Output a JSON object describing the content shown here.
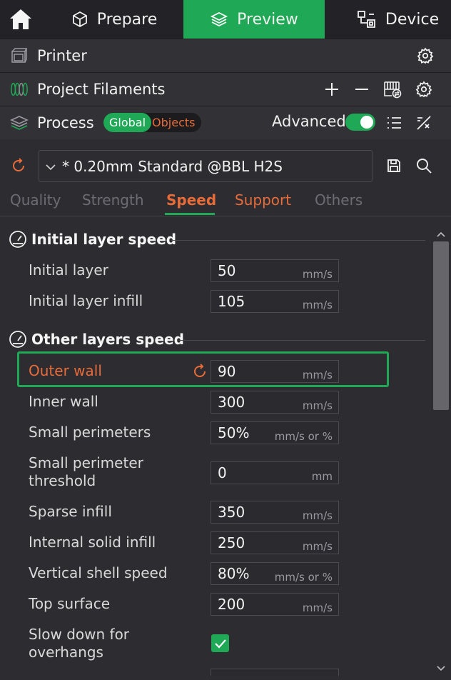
{
  "nav": {
    "tabs": [
      {
        "label": "Prepare",
        "icon": "cube-icon"
      },
      {
        "label": "Preview",
        "icon": "layers-icon",
        "active": true
      },
      {
        "label": "Device",
        "icon": "device-icon"
      }
    ]
  },
  "printer_bar": {
    "label": "Printer"
  },
  "filaments_bar": {
    "label": "Project Filaments"
  },
  "process_bar": {
    "label": "Process",
    "scope_global": "Global",
    "scope_objects": "Objects",
    "advanced_label": "Advanced",
    "advanced_on": true
  },
  "preset": {
    "name": "* 0.20mm Standard @BBL H2S"
  },
  "tabs": [
    "Quality",
    "Strength",
    "Speed",
    "Support",
    "Others"
  ],
  "active_tab": "Speed",
  "sections": {
    "initial": "Initial layer speed",
    "other": "Other layers speed"
  },
  "rows": [
    {
      "label": "Initial layer",
      "value": "50",
      "unit": "mm/s"
    },
    {
      "label": "Initial layer infill",
      "value": "105",
      "unit": "mm/s"
    },
    {
      "label": "Outer wall",
      "value": "90",
      "unit": "mm/s",
      "modified": true
    },
    {
      "label": "Inner wall",
      "value": "300",
      "unit": "mm/s"
    },
    {
      "label": "Small perimeters",
      "value": "50%",
      "unit": "mm/s or %"
    },
    {
      "label": "Small perimeter threshold",
      "label_lines": [
        "Small perimeter",
        "threshold"
      ],
      "value": "0",
      "unit": "mm"
    },
    {
      "label": "Sparse infill",
      "value": "350",
      "unit": "mm/s"
    },
    {
      "label": "Internal solid infill",
      "value": "250",
      "unit": "mm/s"
    },
    {
      "label": "Vertical shell speed",
      "value": "80%",
      "unit": "mm/s or %"
    },
    {
      "label": "Top surface",
      "value": "200",
      "unit": "mm/s"
    },
    {
      "label": "Slow down for overhangs",
      "label_lines": [
        "Slow down for",
        "overhangs"
      ],
      "checked": true
    }
  ],
  "colors": {
    "accent_green": "#1fa855",
    "accent_orange": "#e86b3a",
    "background": "#2d2d31"
  }
}
